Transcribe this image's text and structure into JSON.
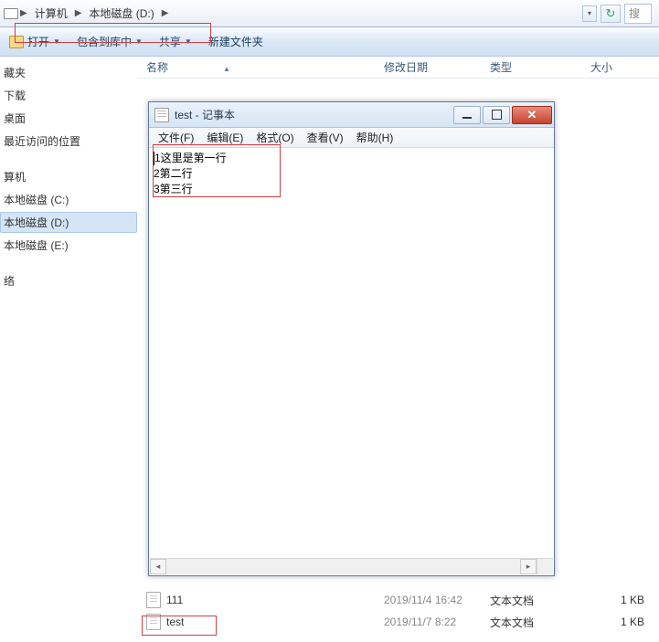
{
  "addressbar": {
    "crumbs": [
      "计算机",
      "本地磁盘 (D:)"
    ],
    "search_placeholder": "搜"
  },
  "toolbar": {
    "open": "打开",
    "include": "包含到库中",
    "share": "共享",
    "newfolder": "新建文件夹"
  },
  "sidebar": {
    "fav": "藏夹",
    "downloads": "下载",
    "desktop": "桌面",
    "recent": "最近访问的位置",
    "computer": "算机",
    "c": "本地磁盘 (C:)",
    "d": "本地磁盘 (D:)",
    "e": "本地磁盘 (E:)",
    "network": "络"
  },
  "columns": {
    "name": "名称",
    "date": "修改日期",
    "type": "类型",
    "size": "大小"
  },
  "files": [
    {
      "name": "111",
      "date": "2019/11/4 16:42",
      "type": "文本文档",
      "size": "1 KB"
    },
    {
      "name": "test",
      "date": "2019/11/7 8:22",
      "type": "文本文档",
      "size": "1 KB"
    }
  ],
  "notepad": {
    "title": "test - 记事本",
    "menu": {
      "file": "文件(F)",
      "edit": "编辑(E)",
      "format": "格式(O)",
      "view": "查看(V)",
      "help": "帮助(H)"
    },
    "lines": [
      "1这里是第一行",
      "2第二行",
      "3第三行"
    ]
  }
}
